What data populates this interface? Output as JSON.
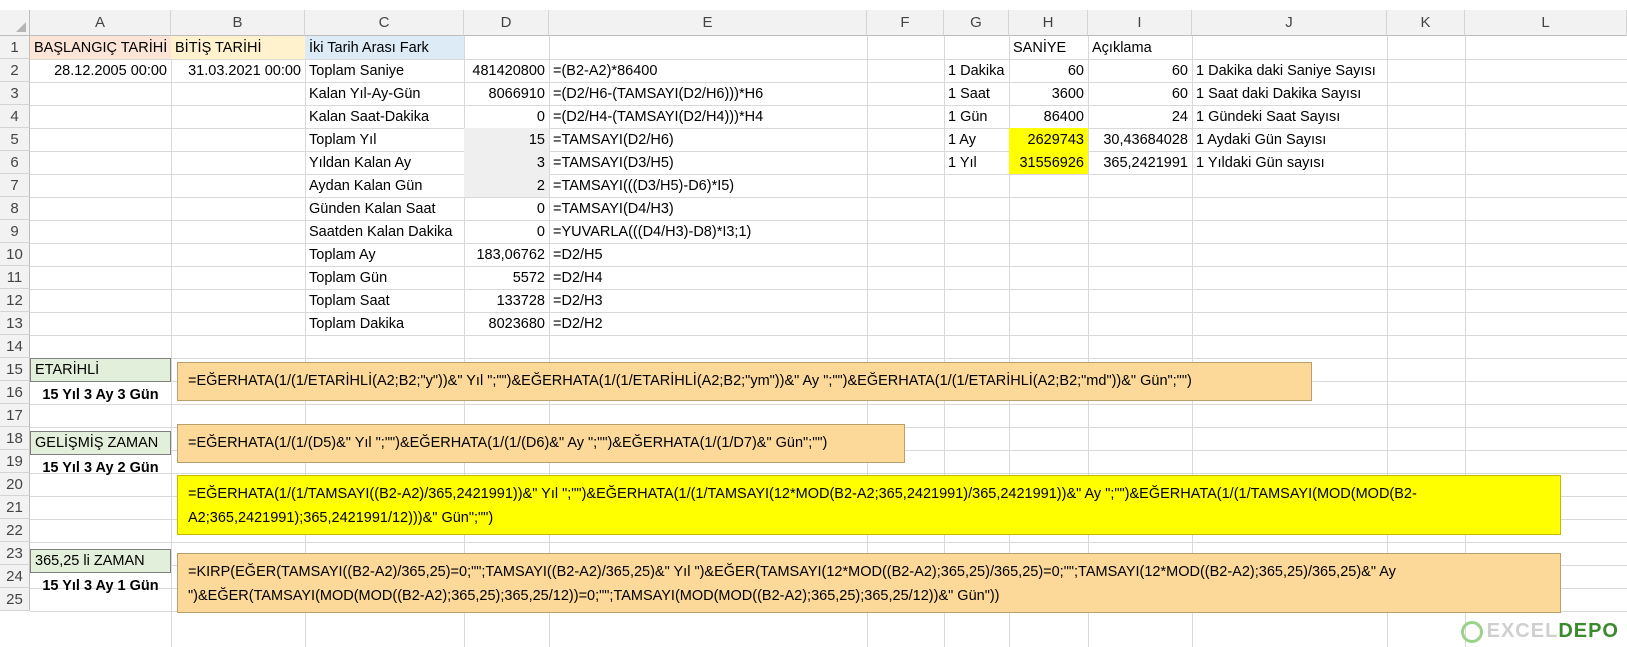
{
  "columns": [
    "A",
    "B",
    "C",
    "D",
    "E",
    "F",
    "G",
    "H",
    "I",
    "J",
    "K",
    "L"
  ],
  "rows": [
    "1",
    "2",
    "3",
    "4",
    "5",
    "6",
    "7",
    "8",
    "9",
    "10",
    "11",
    "12",
    "13",
    "14",
    "15",
    "16",
    "17",
    "18",
    "19",
    "20",
    "21",
    "22",
    "23",
    "24",
    "25"
  ],
  "cells": {
    "A1": "BAŞLANGIÇ TARİHİ",
    "B1": "BİTİŞ TARİHİ",
    "C1": "İki Tarih Arası Fark",
    "H1": "SANİYE",
    "I1": "Açıklama",
    "A2": "28.12.2005 00:00",
    "B2": "31.03.2021 00:00",
    "C2": "Toplam Saniye",
    "D2": "481420800",
    "E2": "=(B2-A2)*86400",
    "G2": "1 Dakika",
    "H2": "60",
    "I2": "60",
    "J2": "1 Dakika daki Saniye Sayısı",
    "C3": "Kalan Yıl-Ay-Gün",
    "D3": "8066910",
    "E3": "=(D2/H6-(TAMSAYI(D2/H6)))*H6",
    "G3": "1 Saat",
    "H3": "3600",
    "I3": "60",
    "J3": "1 Saat daki Dakika Sayısı",
    "C4": "Kalan Saat-Dakika",
    "D4": "0",
    "E4": "=(D2/H4-(TAMSAYI(D2/H4)))*H4",
    "G4": "1 Gün",
    "H4": "86400",
    "I4": "24",
    "J4": "1 Gündeki Saat Sayısı",
    "C5": "Toplam Yıl",
    "D5": "15",
    "E5": "=TAMSAYI(D2/H6)",
    "G5": "1 Ay",
    "H5": "2629743",
    "I5": "30,43684028",
    "J5": "1 Aydaki Gün Sayısı",
    "C6": "Yıldan Kalan Ay",
    "D6": "3",
    "E6": "=TAMSAYI(D3/H5)",
    "G6": "1 Yıl",
    "H6": "31556926",
    "I6": "365,2421991",
    "J6": "1 Yıldaki Gün sayısı",
    "C7": "Aydan Kalan Gün",
    "D7": "2",
    "E7": "=TAMSAYI(((D3/H5)-D6)*I5)",
    "C8": "Günden Kalan Saat",
    "D8": "0",
    "E8": "=TAMSAYI(D4/H3)",
    "C9": "Saatden Kalan Dakika",
    "D9": "0",
    "E9": "=YUVARLA(((D4/H3)-D8)*I3;1)",
    "C10": "Toplam Ay",
    "D10": "183,06762",
    "E10": "=D2/H5",
    "C11": "Toplam Gün",
    "D11": "5572",
    "E11": "=D2/H4",
    "C12": "Toplam Saat",
    "D12": "133728",
    "E12": "=D2/H3",
    "C13": "Toplam Dakika",
    "D13": "8023680",
    "E13": "=D2/H2",
    "A15": "ETARİHLİ",
    "A16": "15 Yıl 3 Ay 3 Gün",
    "A18": "GELİŞMİŞ ZAMAN",
    "A19": "15 Yıl 3 Ay 2 Gün",
    "A23": "365,25 li ZAMAN",
    "A24": "15 Yıl 3 Ay 1 Gün"
  },
  "formula_boxes": {
    "f15": "=EĞERHATA(1/(1/ETARİHLİ(A2;B2;\"y\"))&\" Yıl \";\"\")&EĞERHATA(1/(1/ETARİHLİ(A2;B2;\"ym\"))&\" Ay \";\"\")&EĞERHATA(1/(1/ETARİHLİ(A2;B2;\"md\"))&\" Gün\";\"\")",
    "f18": "=EĞERHATA(1/(1/(D5)&\" Yıl \";\"\")&EĞERHATA(1/(1/(D6)&\" Ay \";\"\")&EĞERHATA(1/(1/D7)&\" Gün\";\"\")",
    "f20": "=EĞERHATA(1/(1/TAMSAYI((B2-A2)/365,2421991))&\" Yıl \";\"\")&EĞERHATA(1/(1/TAMSAYI(12*MOD(B2-A2;365,2421991)/365,2421991))&\" Ay \";\"\")&EĞERHATA(1/(1/TAMSAYI(MOD(MOD(B2-A2;365,2421991);365,2421991/12)))&\" Gün\";\"\")",
    "f23": "=KIRP(EĞER(TAMSAYI((B2-A2)/365,25)=0;\"\";TAMSAYI((B2-A2)/365,25)&\" Yıl  \")&EĞER(TAMSAYI(12*MOD((B2-A2);365,25)/365,25)=0;\"\";TAMSAYI(12*MOD((B2-A2);365,25)/365,25)&\" Ay \")&EĞER(TAMSAYI(MOD(MOD((B2-A2);365,25);365,25/12))=0;\"\";TAMSAYI(MOD(MOD((B2-A2);365,25);365,25/12))&\" Gün\"))"
  },
  "logo": {
    "text1": "EXCEL",
    "text2": "DEPO"
  },
  "colors": {
    "header_fill_a1": "#fce4d6",
    "header_fill_b1": "#fff2cc",
    "header_fill_c1": "#ddebf7",
    "highlight_yellow": "#ffff00",
    "formula_orange": "#fcd998",
    "label_green": "#e2efda",
    "grey_fill": "#f2f2f2"
  }
}
